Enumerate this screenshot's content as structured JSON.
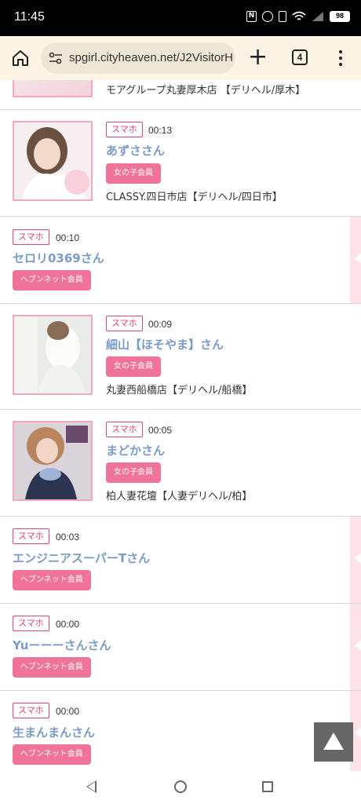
{
  "status_bar": {
    "time": "11:45",
    "battery": "98"
  },
  "browser": {
    "url": "spgirl.cityheaven.net/J2VisitorH",
    "tab_count": "4"
  },
  "partial_row": {
    "shop": "モアグループ丸妻厚木店 【デリヘル/厚木】"
  },
  "rows": [
    {
      "device": "スマホ",
      "time": "00:13",
      "name": "あずささん",
      "member": "女の子会員",
      "shop": "CLASSY.四日市店【デリヘル/四日市】"
    },
    {
      "device": "スマホ",
      "time": "00:10",
      "name": "セロリ0369さん",
      "member": "ヘブンネット会員"
    },
    {
      "device": "スマホ",
      "time": "00:09",
      "name": "細山【ほそやま】さん",
      "member": "女の子会員",
      "shop": "丸妻西船橋店【デリヘル/船橋】"
    },
    {
      "device": "スマホ",
      "time": "00:05",
      "name": "まどかさん",
      "member": "女の子会員",
      "shop": "柏人妻花壇【人妻デリヘル/柏】"
    },
    {
      "device": "スマホ",
      "time": "00:03",
      "name": "エンジニアスーパーTさん",
      "member": "ヘブンネット会員"
    },
    {
      "device": "スマホ",
      "time": "00:00",
      "name": "Yuーーーさんさん",
      "member": "ヘブンネット会員"
    },
    {
      "device": "スマホ",
      "time": "00:00",
      "name": "生まんまんさん",
      "member": "ヘブンネット会員"
    }
  ],
  "icons": {
    "home": "home-icon",
    "site_info": "tune-icon",
    "new_tab": "plus-icon",
    "tabs": "tab-switcher-icon",
    "menu": "more-vert-icon",
    "scroll_top": "arrow-up-icon"
  },
  "colors": {
    "accent_pink": "#f0749a",
    "name_blue": "#7a9cc6",
    "tag_red": "#e0427c"
  }
}
